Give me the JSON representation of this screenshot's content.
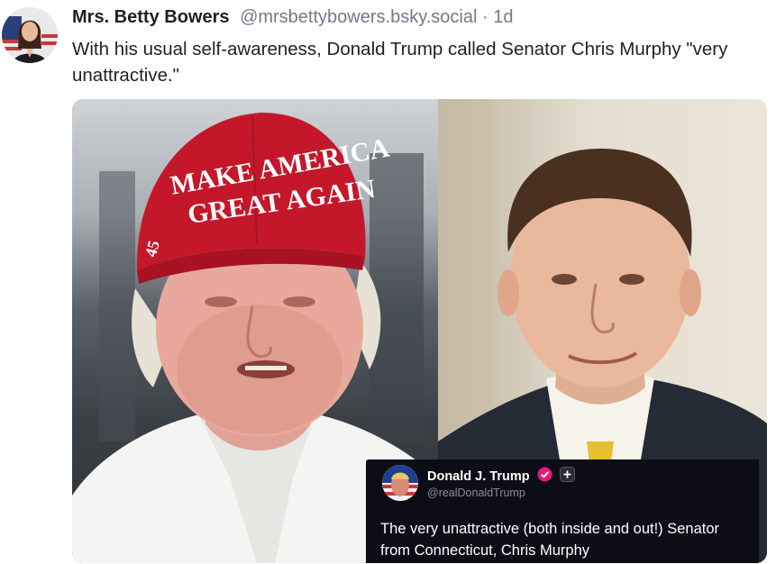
{
  "post": {
    "author_name": "Mrs. Betty Bowers",
    "author_handle": "@mrsbettybowers.bsky.social",
    "separator": "·",
    "time_ago": "1d",
    "text": "With his usual self-awareness, Donald Trump called Senator Chris Murphy \"very unattractive.\""
  },
  "embed": {
    "hat_line1": "MAKE AMERICA",
    "hat_line2": "GREAT AGAIN",
    "hat_side": "45",
    "quoted_post": {
      "author_name": "Donald J. Trump",
      "author_handle": "@realDonaldTrump",
      "text": "The very unattractive (both inside and out!) Senator from Connecticut, Chris Murphy"
    }
  },
  "colors": {
    "text_primary": "#1c2127",
    "text_secondary": "#6f7b87",
    "hat_red": "#c4182a",
    "badge_pink": "#e6197a",
    "card_bg": "#0d0d17"
  },
  "icons": {
    "verified": "verified-badge-icon",
    "add": "plus-badge-icon"
  }
}
